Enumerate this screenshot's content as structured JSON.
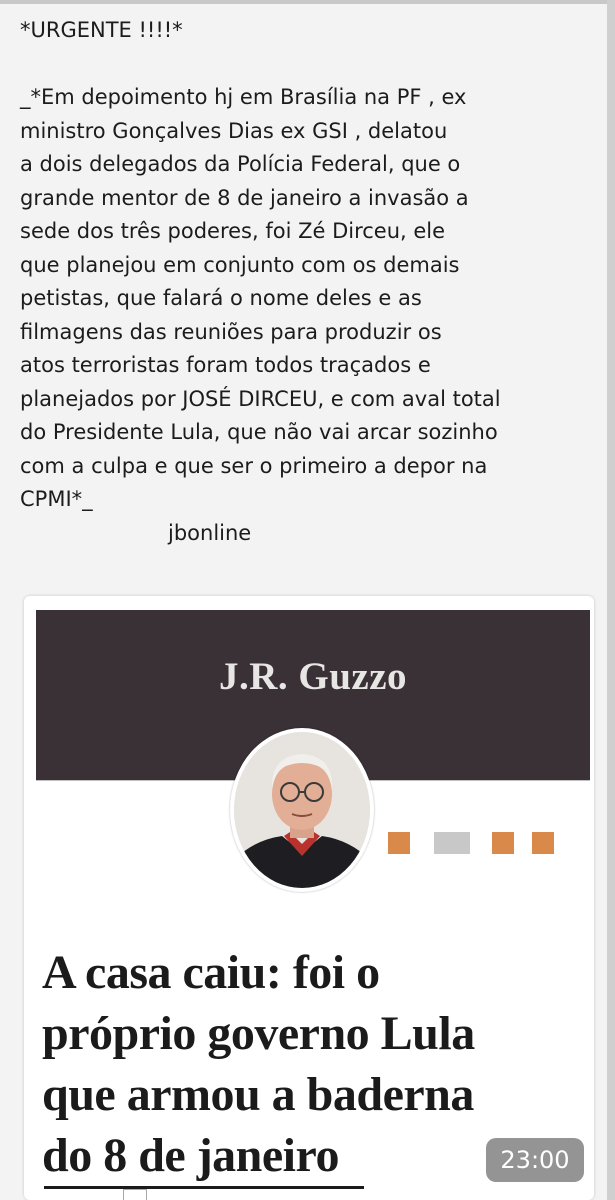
{
  "message": {
    "lines": [
      "*URGENTE !!!!*",
      "",
      "_*Em depoimento hj em Brasília na PF , ex",
      "ministro Gonçalves Dias ex GSI , delatou",
      "a dois delegados da Polícia Federal, que o",
      "grande mentor de 8 de janeiro a invasão a",
      "sede dos três poderes, foi Zé Dirceu, ele",
      "que planejou em conjunto com os demais",
      "petistas, que falará o nome deles e as",
      "filmagens das reuniões para produzir os",
      "atos terroristas foram todos traçados e",
      "planejados por JOSÉ DIRCEU, e com aval total",
      "do Presidente Lula, que não vai arcar sozinho",
      "com a culpa e que ser o primeiro a depor na",
      "CPMI*_"
    ],
    "source": "jbonline"
  },
  "article": {
    "author": "J.R. Guzzo",
    "headline_lines": [
      "A casa caiu: foi o",
      "próprio governo Lula",
      "que armou a baderna",
      "do 8 de janeiro"
    ],
    "decoration_colors": [
      "#d98a4a",
      "#c8c8c8",
      "#d98a4a",
      "#d98a4a"
    ]
  },
  "video": {
    "timestamp": "23:00"
  },
  "colors": {
    "banner": "#3a3136",
    "accent": "#d98a4a",
    "text": "#1c1c1c"
  }
}
